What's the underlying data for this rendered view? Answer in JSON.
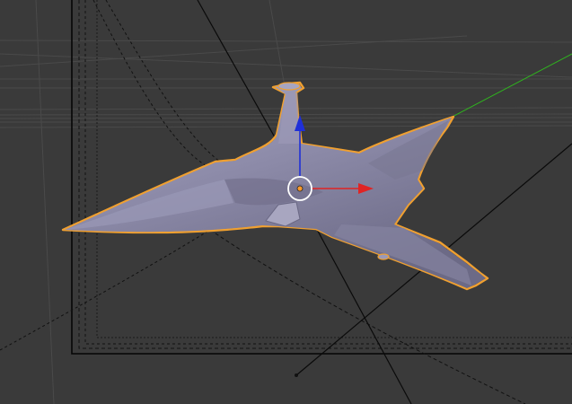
{
  "viewport": {
    "background_color": "#3a3a3a",
    "grid_color": "#4b4b4b",
    "camera_frame_color": "#050505",
    "selection_outline_color": "#f0a030",
    "mesh_color": "#8e8ca8",
    "gizmo": {
      "x_axis_color": "#e02424",
      "y_axis_color": "#2fb41e",
      "z_axis_color": "#1f2fd8",
      "origin_color": "#ff9a2a"
    },
    "selected_object_icon": "jet-fighter-mesh",
    "cursor_icon": "3d-cursor"
  }
}
